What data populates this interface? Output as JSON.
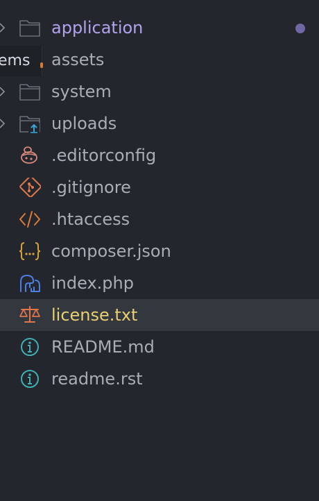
{
  "explorer": {
    "tooltip_text": "ems",
    "items": [
      {
        "label": "application",
        "icon": "folder-icon",
        "kind": "folder",
        "expandable": true,
        "modified_dot": true
      },
      {
        "label": "assets",
        "icon": "folder-icon",
        "kind": "folder",
        "expandable": true
      },
      {
        "label": "system",
        "icon": "folder-icon",
        "kind": "folder",
        "expandable": true
      },
      {
        "label": "uploads",
        "icon": "folder-upload-icon",
        "kind": "folder",
        "expandable": true
      },
      {
        "label": ".editorconfig",
        "icon": "editorconfig-icon",
        "kind": "file"
      },
      {
        "label": ".gitignore",
        "icon": "git-icon",
        "kind": "file"
      },
      {
        "label": ".htaccess",
        "icon": "code-icon",
        "kind": "file"
      },
      {
        "label": "composer.json",
        "icon": "json-braces-icon",
        "kind": "file"
      },
      {
        "label": "index.php",
        "icon": "php-elephant-icon",
        "kind": "file"
      },
      {
        "label": "license.txt",
        "icon": "license-scale-icon",
        "kind": "file",
        "selected": true
      },
      {
        "label": "README.md",
        "icon": "info-icon",
        "kind": "file"
      },
      {
        "label": "readme.rst",
        "icon": "info-icon",
        "kind": "file"
      }
    ],
    "colors": {
      "background": "#23262c",
      "selected_row": "#33373e",
      "label": "#a9aeb6",
      "folder_accent_label": "#b3a2ee",
      "selected_label": "#e9cf72",
      "modified_dot": "#6f68a4"
    }
  }
}
